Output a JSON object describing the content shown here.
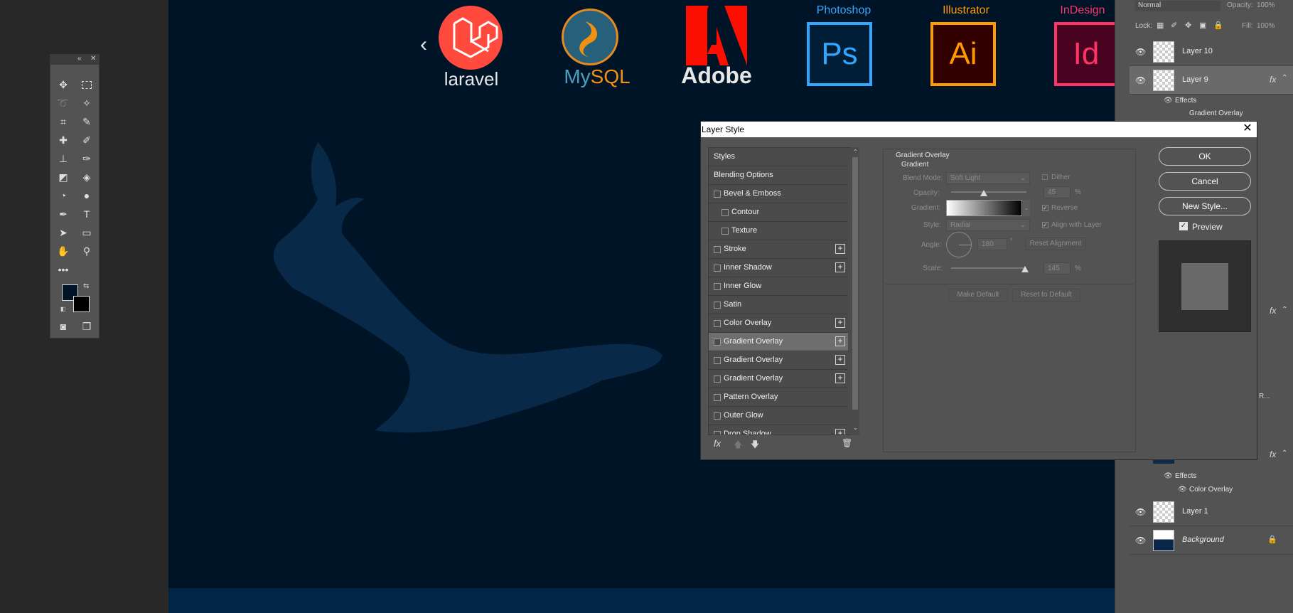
{
  "canvas": {
    "logos": {
      "laravel": "laravel",
      "mysql_my": "My",
      "mysql_sql": "SQL",
      "adobe": "Adobe",
      "photoshop_caption": "Photoshop",
      "photoshop_mark": "Ps",
      "illustrator_caption": "Illustrator",
      "illustrator_mark": "Ai",
      "indesign_caption": "InDesign",
      "indesign_mark": "Id"
    },
    "prev_arrow": "‹"
  },
  "layers_panel": {
    "blend_mode": "Normal",
    "opacity_label": "Opacity:",
    "opacity_value": "100%",
    "lock_label": "Lock:",
    "fill_label": "Fill:",
    "fill_value": "100%",
    "layers": [
      {
        "name": "Layer 10"
      },
      {
        "name": "Layer 9"
      },
      {
        "name": "Layer 1"
      },
      {
        "name": "Background"
      }
    ],
    "effects_label": "Effects",
    "effect_gradient_overlay": "Gradient Overlay",
    "effects_label_2": "Effects",
    "effect_color_overlay": "Color Overlay",
    "fx": "fx",
    "truncated_text": "R..."
  },
  "dialog": {
    "title": "Layer Style",
    "close": "✕",
    "styles": [
      {
        "label": "Styles",
        "checkbox": false,
        "plus": false,
        "indent": 0
      },
      {
        "label": "Blending Options",
        "checkbox": false,
        "plus": false,
        "indent": 0
      },
      {
        "label": "Bevel & Emboss",
        "checkbox": true,
        "plus": false,
        "indent": 0
      },
      {
        "label": "Contour",
        "checkbox": true,
        "plus": false,
        "indent": 1
      },
      {
        "label": "Texture",
        "checkbox": true,
        "plus": false,
        "indent": 1
      },
      {
        "label": "Stroke",
        "checkbox": true,
        "plus": true,
        "indent": 0
      },
      {
        "label": "Inner Shadow",
        "checkbox": true,
        "plus": true,
        "indent": 0
      },
      {
        "label": "Inner Glow",
        "checkbox": true,
        "plus": false,
        "indent": 0
      },
      {
        "label": "Satin",
        "checkbox": true,
        "plus": false,
        "indent": 0
      },
      {
        "label": "Color Overlay",
        "checkbox": true,
        "plus": true,
        "indent": 0
      },
      {
        "label": "Gradient Overlay",
        "checkbox": true,
        "plus": true,
        "indent": 0
      },
      {
        "label": "Gradient Overlay",
        "checkbox": true,
        "plus": true,
        "indent": 0
      },
      {
        "label": "Gradient Overlay",
        "checkbox": true,
        "plus": true,
        "indent": 0
      },
      {
        "label": "Pattern Overlay",
        "checkbox": true,
        "plus": false,
        "indent": 0
      },
      {
        "label": "Outer Glow",
        "checkbox": true,
        "plus": false,
        "indent": 0
      },
      {
        "label": "Drop Shadow",
        "checkbox": true,
        "plus": true,
        "indent": 0
      }
    ],
    "selected_index": 10,
    "fx": "fx",
    "section_title": "Gradient Overlay",
    "subsection_title": "Gradient",
    "blend_mode_label": "Blend Mode:",
    "blend_mode_value": "Soft Light",
    "dither_label": "Dither",
    "opacity_label": "Opacity:",
    "opacity_value": "45",
    "percent": "%",
    "gradient_label": "Gradient:",
    "reverse_label": "Reverse",
    "style_label": "Style:",
    "style_value": "Radial",
    "align_label": "Align with Layer",
    "angle_label": "Angle:",
    "angle_value": "180",
    "degree": "°",
    "reset_alignment": "Reset Alignment",
    "scale_label": "Scale:",
    "scale_value": "145",
    "percent2": "%",
    "make_default": "Make Default",
    "reset_default": "Reset to Default",
    "ok": "OK",
    "cancel": "Cancel",
    "new_style": "New Style...",
    "preview_label": "Preview"
  },
  "colors": {
    "canvas_bg": "#001428",
    "photoshop": "#31a8ff",
    "illustrator": "#ff9a00",
    "indesign": "#ff3366",
    "laravel": "#ff2d20",
    "adobe_red": "#fa0f00",
    "mysql_blue": "#00758f",
    "mysql_orange": "#f29111"
  }
}
